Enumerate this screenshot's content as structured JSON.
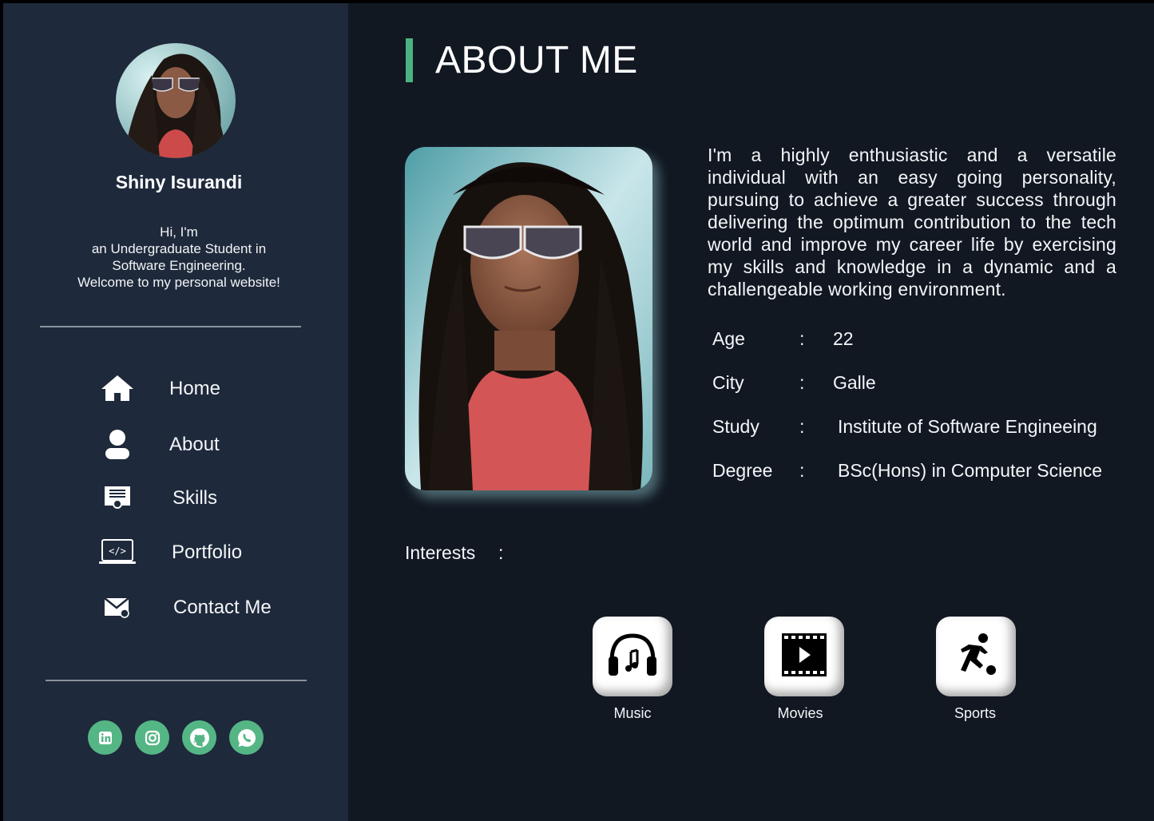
{
  "profile": {
    "name": "Shiny Isurandi",
    "intro_lines": [
      "Hi, I'm",
      "an Undergraduate Student in",
      "Software Engineering.",
      "Welcome to my personal website!"
    ]
  },
  "nav": {
    "items": [
      {
        "label": "Home",
        "icon": "home-icon"
      },
      {
        "label": "About",
        "icon": "user-icon"
      },
      {
        "label": "Skills",
        "icon": "certificate-icon"
      },
      {
        "label": "Portfolio",
        "icon": "code-laptop-icon"
      },
      {
        "label": "Contact Me",
        "icon": "mail-icon"
      }
    ]
  },
  "social": [
    "linkedin-icon",
    "instagram-icon",
    "github-icon",
    "whatsapp-icon"
  ],
  "main": {
    "title": "ABOUT ME",
    "bio": "I'm a highly enthusiastic and a versatile individual with an easy going personality, pursuing to achieve a greater success through delivering the optimum contribution to the tech world and improve my career life by exercising my skills and knowledge in a dynamic and a challengeable working environment.",
    "info": [
      {
        "key": "Age",
        "value": "22"
      },
      {
        "key": "City",
        "value": "Galle"
      },
      {
        "key": "Study",
        "value": "Institute of Software Engineeing"
      },
      {
        "key": "Degree",
        "value": "BSc(Hons) in Computer Science"
      }
    ],
    "info_separator": ":",
    "interests_label": "Interests",
    "interests_separator": ":",
    "interests": [
      {
        "label": "Music",
        "icon": "headphones-icon"
      },
      {
        "label": "Movies",
        "icon": "film-icon"
      },
      {
        "label": "Sports",
        "icon": "soccer-player-icon"
      }
    ]
  },
  "colors": {
    "sidebar_bg": "#1e293b",
    "main_bg": "#111822",
    "accent": "#4cb27f",
    "social_bg": "#55b685"
  }
}
